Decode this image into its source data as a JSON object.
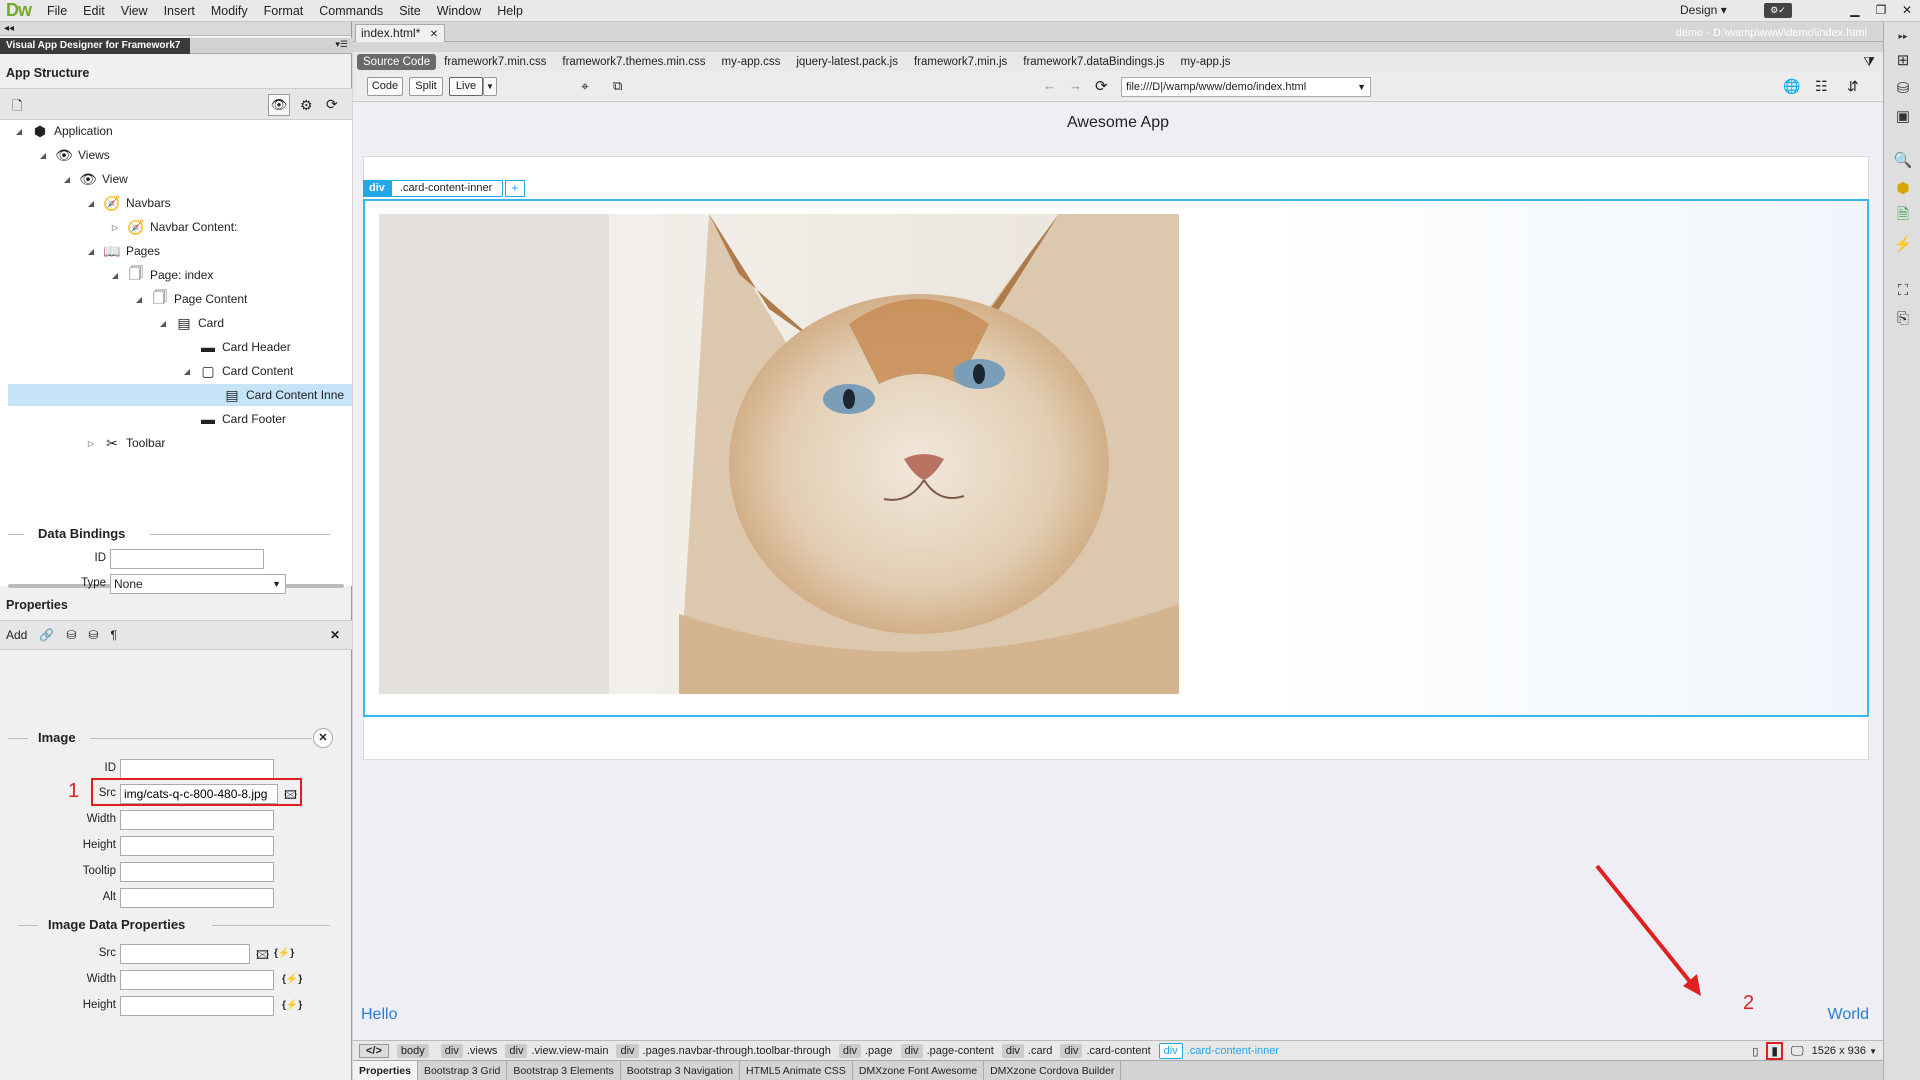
{
  "app": {
    "logo": "Dw"
  },
  "menu": [
    "File",
    "Edit",
    "View",
    "Insert",
    "Modify",
    "Format",
    "Commands",
    "Site",
    "Window",
    "Help"
  ],
  "workspace": {
    "label": "Design"
  },
  "left_panel": {
    "plugin_tab": "Visual App Designer for Framework7",
    "app_structure_title": "App Structure",
    "tree": [
      {
        "label": "Application",
        "icon": "cube-icon"
      },
      {
        "label": "Views",
        "icon": "eye-icon"
      },
      {
        "label": "View",
        "icon": "eye-icon"
      },
      {
        "label": "Navbars",
        "icon": "compass-icon"
      },
      {
        "label": "Navbar Content:",
        "icon": "compass-icon"
      },
      {
        "label": "Pages",
        "icon": "book-icon"
      },
      {
        "label": "Page: index",
        "icon": "page-icon"
      },
      {
        "label": "Page Content",
        "icon": "page-icon"
      },
      {
        "label": "Card",
        "icon": "card-icon"
      },
      {
        "label": "Card Header",
        "icon": "dash-icon"
      },
      {
        "label": "Card Content",
        "icon": "square-icon"
      },
      {
        "label": "Card Content Inne",
        "icon": "card-icon"
      },
      {
        "label": "Card Footer",
        "icon": "dash-icon"
      },
      {
        "label": "Toolbar",
        "icon": "tools-icon"
      }
    ],
    "properties_title": "Properties",
    "props_toolbar": {
      "add_label": "Add"
    },
    "data_bindings": {
      "title": "Data Bindings",
      "id_label": "ID",
      "id_value": "",
      "type_label": "Type",
      "type_value": "None"
    },
    "image": {
      "title": "Image",
      "id_label": "ID",
      "src_label": "Src",
      "src_value": "img/cats-q-c-800-480-8.jpg",
      "width_label": "Width",
      "height_label": "Height",
      "tooltip_label": "Tooltip",
      "alt_label": "Alt"
    },
    "image_data": {
      "title": "Image Data Properties",
      "src_label": "Src",
      "width_label": "Width",
      "height_label": "Height",
      "dyn_symbol": "{⚡}"
    },
    "annotation_1": "1"
  },
  "document": {
    "tab_title": "index.html*",
    "path": "demo - D:\\wamp\\www\\demo\\index.html",
    "related_files": [
      "Source Code",
      "framework7.min.css",
      "framework7.themes.min.css",
      "my-app.css",
      "jquery-latest.pack.js",
      "framework7.min.js",
      "framework7.dataBindings.js",
      "my-app.js"
    ],
    "toolbar": {
      "code": "Code",
      "split": "Split",
      "live": "Live",
      "address": "file:///D|/wamp/www/demo/index.html"
    },
    "app_title": "Awesome App",
    "tag_badge": {
      "tag": "div",
      "class": ".card-content-inner",
      "plus": "+"
    },
    "hello": "Hello",
    "world": "World",
    "annotation_2": "2"
  },
  "tag_selector": {
    "code_btn": "</>",
    "tags": [
      {
        "tag": "body",
        "cls": ""
      },
      {
        "tag": "div",
        "cls": ".views"
      },
      {
        "tag": "div",
        "cls": ".view.view-main"
      },
      {
        "tag": "div",
        "cls": ".pages.navbar-through.toolbar-through"
      },
      {
        "tag": "div",
        "cls": ".page"
      },
      {
        "tag": "div",
        "cls": ".page-content"
      },
      {
        "tag": "div",
        "cls": ".card"
      },
      {
        "tag": "div",
        "cls": ".card-content"
      },
      {
        "tag": "div",
        "cls": ".card-content-inner",
        "active": true
      }
    ],
    "resolution": "1526 x 936"
  },
  "bottom_tabs": [
    "Properties",
    "Bootstrap 3 Grid",
    "Bootstrap 3 Elements",
    "Bootstrap 3 Navigation",
    "HTML5 Animate CSS",
    "DMXzone Font Awesome",
    "DMXzone Cordova Builder"
  ],
  "colors": {
    "accent": "#22a7e8",
    "annotation": "#e02020",
    "link": "#2a7ed8"
  }
}
